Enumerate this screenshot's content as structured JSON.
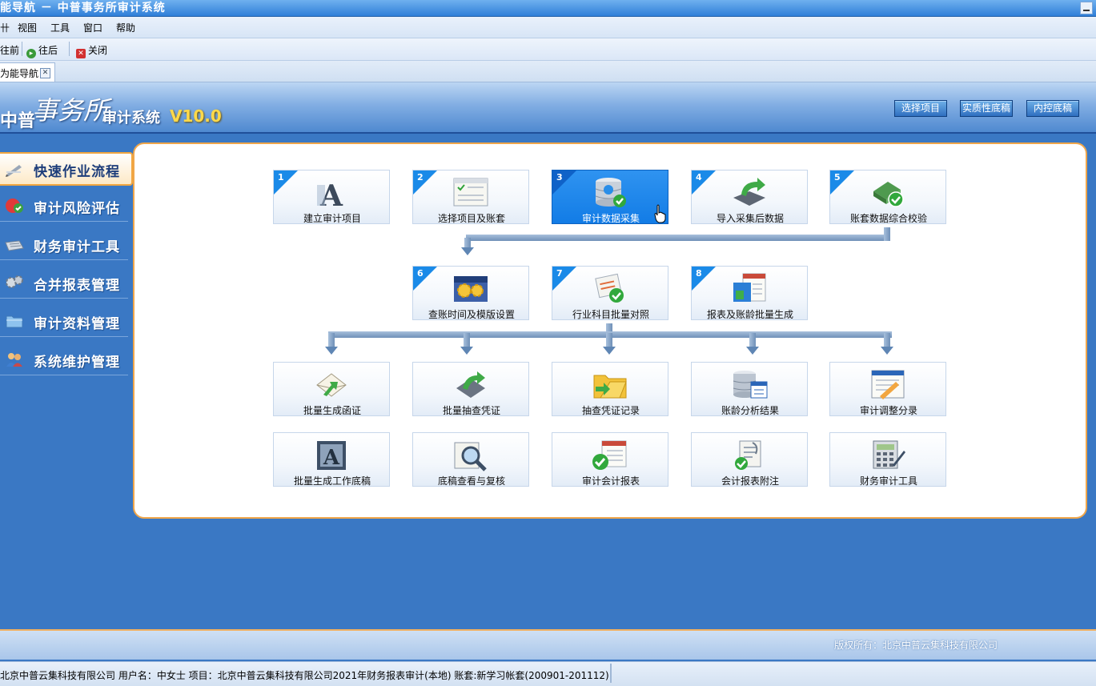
{
  "window": {
    "title": "能导航 － 中普事务所审计系统"
  },
  "menu": [
    "卄",
    "视图",
    "工具",
    "窗口",
    "帮助"
  ],
  "toolbar": {
    "back": "往前",
    "forward": "往后",
    "close": "关闭"
  },
  "tab": {
    "label": "为能导航"
  },
  "header": {
    "logo_zp": "中普",
    "logo_sws": "事务所",
    "logo_sys": "审计系统",
    "logo_version": "V10.0",
    "buttons": [
      "选择项目",
      "实质性底稿",
      "内控底稿"
    ]
  },
  "sidebar": [
    {
      "label": "快速作业流程",
      "icon": "pen-icon"
    },
    {
      "label": "审计风险评估",
      "icon": "risk-check-icon"
    },
    {
      "label": "财务审计工具",
      "icon": "keyboard-icon"
    },
    {
      "label": "合并报表管理",
      "icon": "gears-icon"
    },
    {
      "label": "审计资料管理",
      "icon": "folder-icon"
    },
    {
      "label": "系统维护管理",
      "icon": "users-icon"
    }
  ],
  "steps": [
    {
      "num": "1",
      "label": "建立审计项目",
      "icon": "letter-a-icon"
    },
    {
      "num": "2",
      "label": "选择项目及账套",
      "icon": "checklist-window-icon"
    },
    {
      "num": "3",
      "label": "审计数据采集",
      "icon": "database-check-icon"
    },
    {
      "num": "4",
      "label": "导入采集后数据",
      "icon": "import-arrow-icon"
    },
    {
      "num": "5",
      "label": "账套数据综合校验",
      "icon": "verify-check-icon"
    },
    {
      "num": "6",
      "label": "查账时间及模版设置",
      "icon": "calendar-gear-icon"
    },
    {
      "num": "7",
      "label": "行业科目批量对照",
      "icon": "compare-check-icon"
    },
    {
      "num": "8",
      "label": "报表及账龄批量生成",
      "icon": "report-window-icon"
    }
  ],
  "tools": [
    {
      "label": "批量生成函证",
      "icon": "envelope-arrow-icon"
    },
    {
      "label": "批量抽查凭证",
      "icon": "voucher-arrow-icon"
    },
    {
      "label": "抽查凭证记录",
      "icon": "folder-arrow-icon"
    },
    {
      "label": "账龄分析结果",
      "icon": "database-table-icon"
    },
    {
      "label": "审计调整分录",
      "icon": "window-edit-icon"
    },
    {
      "label": "批量生成工作底稿",
      "icon": "book-a-icon"
    },
    {
      "label": "底稿查看与复核",
      "icon": "magnifier-icon"
    },
    {
      "label": "审计会计报表",
      "icon": "check-window-icon"
    },
    {
      "label": "会计报表附注",
      "icon": "notes-check-icon"
    },
    {
      "label": "财务审计工具",
      "icon": "calculator-icon"
    }
  ],
  "footer": {
    "copyright": "版权所有：北京中普云集科技有限公司"
  },
  "status": {
    "text": "北京中普云集科技有限公司 用户名：中女士 项目：北京中普云集科技有限公司2021年财务报表审计(本地)   账套:新学习帐套(200901-201112)"
  },
  "colors": {
    "accent": "#1a8ae8",
    "panel_border": "#f0a64a",
    "background": "#3a78c4"
  }
}
